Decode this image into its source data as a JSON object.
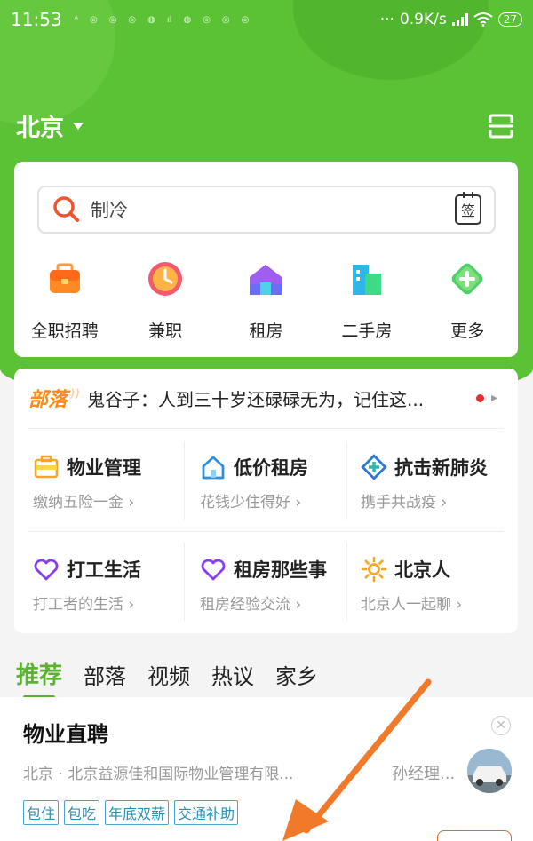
{
  "status_bar": {
    "time": "11:53",
    "network_speed": "0.9K/s",
    "battery": "27",
    "notification_icons": [
      "sim-icon",
      "ac-icon",
      "dot-icon",
      "dot-icon",
      "app-icon",
      "dot-icon",
      "app-icon",
      "dot-icon",
      "dot-icon",
      "dot-icon"
    ]
  },
  "header": {
    "city": "北京",
    "scan_icon": "scan-icon"
  },
  "search": {
    "placeholder": "制冷",
    "sign_label": "签"
  },
  "quick_entries": [
    {
      "label": "全职招聘",
      "icon": "briefcase-icon",
      "color": "#ff7a1a"
    },
    {
      "label": "兼职",
      "icon": "clock-icon",
      "color": "#f25a6e"
    },
    {
      "label": "租房",
      "icon": "house-icon",
      "color": "#6a6ff2"
    },
    {
      "label": "二手房",
      "icon": "building-icon",
      "color": "#2fb6e8"
    },
    {
      "label": "更多",
      "icon": "more-icon",
      "color": "#4fcf6a"
    }
  ],
  "tribe": {
    "tag": "部落",
    "headline": "鬼谷子：人到三十岁还碌碌无为，记住这..."
  },
  "topics": [
    {
      "title": "物业管理",
      "subtitle": "缴纳五险一金",
      "icon": "briefcase-outline-icon"
    },
    {
      "title": "低价租房",
      "subtitle": "花钱少住得好",
      "icon": "house-outline-icon"
    },
    {
      "title": "抗击新肺炎",
      "subtitle": "携手共战疫",
      "icon": "medical-cross-icon"
    },
    {
      "title": "打工生活",
      "subtitle": "打工者的生活",
      "icon": "heart-outline-icon"
    },
    {
      "title": "租房那些事",
      "subtitle": "租房经验交流",
      "icon": "heart-outline-icon"
    },
    {
      "title": "北京人",
      "subtitle": "北京人一起聊",
      "icon": "sun-icon"
    }
  ],
  "feed_tabs": [
    "推荐",
    "部落",
    "视频",
    "热议",
    "家乡"
  ],
  "job": {
    "title": "物业直聘",
    "company": "北京 · 北京益源佳和国际物业管理有限...",
    "contact": "孙经理...",
    "tags": [
      "包住",
      "包吃",
      "年底双薪",
      "交通补助"
    ]
  },
  "colors": {
    "brand_green": "#5bc235",
    "tab_active": "#5bb233",
    "annotation_arrow": "#f07a2a"
  }
}
